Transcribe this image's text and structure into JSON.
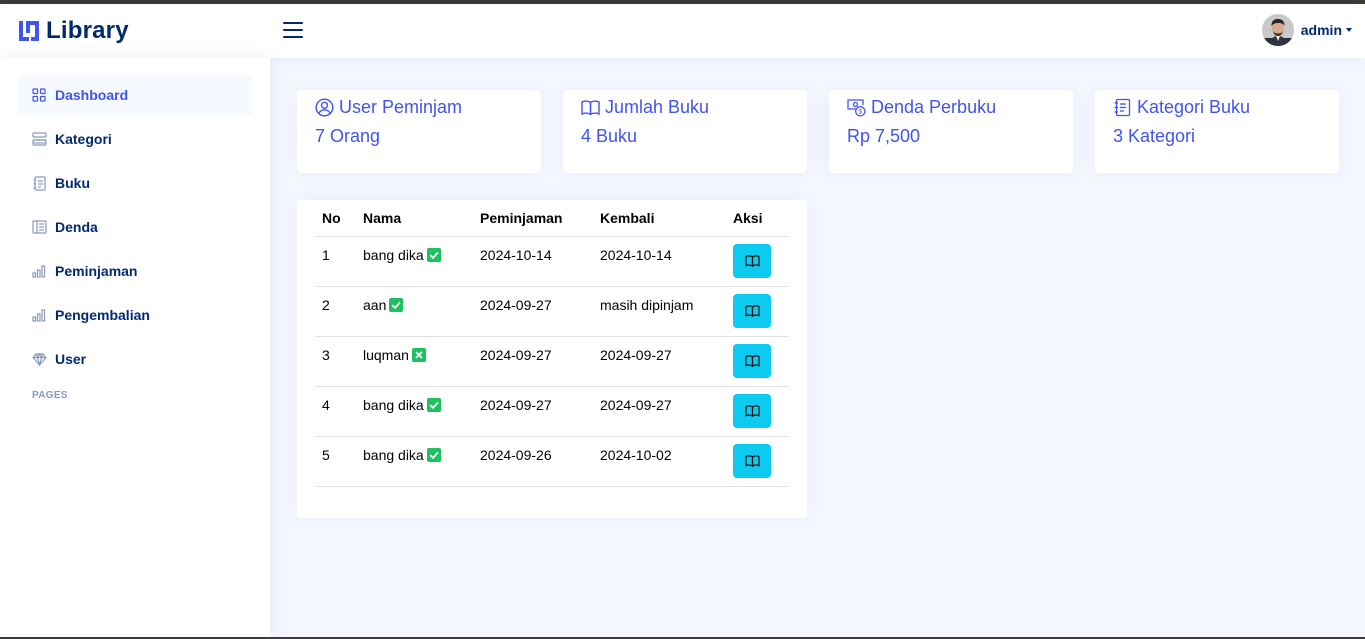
{
  "app": {
    "title": "Library",
    "user_name": "admin"
  },
  "colors": {
    "brand": "#4154f1",
    "navy": "#012970",
    "info_button": "#0dcaf0",
    "badge_green": "#1ec15f"
  },
  "sidebar": {
    "items": [
      {
        "label": "Dashboard",
        "icon": "grid-icon",
        "active": true
      },
      {
        "label": "Kategori",
        "icon": "menu-button-icon"
      },
      {
        "label": "Buku",
        "icon": "journal-text-icon"
      },
      {
        "label": "Denda",
        "icon": "layout-text-sidebar-icon"
      },
      {
        "label": "Peminjaman",
        "icon": "bar-chart-icon"
      },
      {
        "label": "Pengembalian",
        "icon": "bar-chart-icon"
      },
      {
        "label": "User",
        "icon": "gem-icon"
      }
    ],
    "section_heading": "PAGES"
  },
  "cards": [
    {
      "title": "User Peminjam",
      "value": "7 Orang",
      "icon": "person-circle-icon"
    },
    {
      "title": "Jumlah Buku",
      "value": "4 Buku",
      "icon": "book-icon"
    },
    {
      "title": "Denda Perbuku",
      "value": "Rp 7,500",
      "icon": "cash-coin-icon"
    },
    {
      "title": "Kategori Buku",
      "value": "3 Kategori",
      "icon": "journal-icon"
    }
  ],
  "table": {
    "headers": [
      "No",
      "Nama",
      "Peminjaman",
      "Kembali",
      "Aksi"
    ],
    "rows": [
      {
        "no": "1",
        "nama": "bang dika",
        "status": "check",
        "peminjaman": "2024-10-14",
        "kembali": "2024-10-14"
      },
      {
        "no": "2",
        "nama": "aan",
        "status": "check",
        "peminjaman": "2024-09-27",
        "kembali": "masih dipinjam"
      },
      {
        "no": "3",
        "nama": "luqman",
        "status": "x",
        "peminjaman": "2024-09-27",
        "kembali": "2024-09-27"
      },
      {
        "no": "4",
        "nama": "bang dika",
        "status": "check",
        "peminjaman": "2024-09-27",
        "kembali": "2024-09-27"
      },
      {
        "no": "5",
        "nama": "bang dika",
        "status": "check",
        "peminjaman": "2024-09-26",
        "kembali": "2024-10-02"
      }
    ]
  }
}
